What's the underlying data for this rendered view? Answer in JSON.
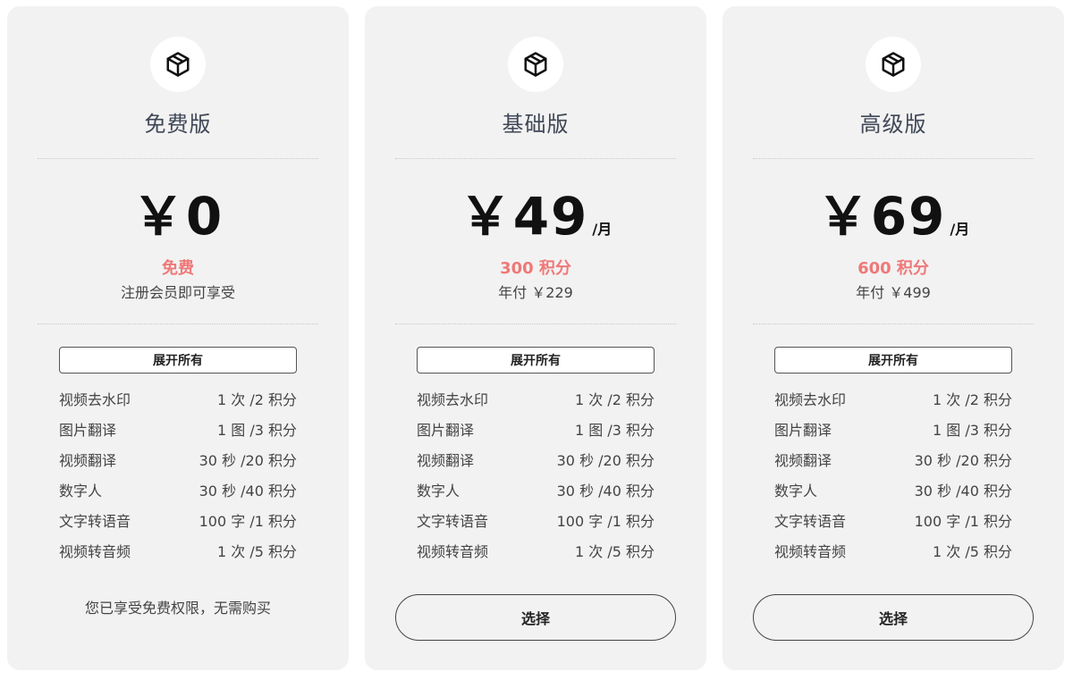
{
  "plans": [
    {
      "name": "免费版",
      "price": "￥0",
      "unit": "",
      "credits": "免费",
      "sub": "注册会员即可享受",
      "expand_label": "展开所有",
      "note": "您已享受免费权限，无需购买",
      "select_label": ""
    },
    {
      "name": "基础版",
      "price": "￥49",
      "unit": "/月",
      "credits": "300 积分",
      "sub": "年付 ￥229",
      "expand_label": "展开所有",
      "note": "",
      "select_label": "选择"
    },
    {
      "name": "高级版",
      "price": "￥69",
      "unit": "/月",
      "credits": "600 积分",
      "sub": "年付 ￥499",
      "expand_label": "展开所有",
      "note": "",
      "select_label": "选择"
    }
  ],
  "features": [
    {
      "name": "视频去水印",
      "cost": "1 次 /2 积分"
    },
    {
      "name": "图片翻译",
      "cost": "1 图 /3 积分"
    },
    {
      "name": "视频翻译",
      "cost": "30 秒 /20 积分"
    },
    {
      "name": "数字人",
      "cost": "30 秒 /40 积分"
    },
    {
      "name": "文字转语音",
      "cost": "100 字 /1 积分"
    },
    {
      "name": "视频转音频",
      "cost": "1 次 /5 积分"
    }
  ],
  "colors": {
    "accent": "#ef7878",
    "card_bg": "#f2f2f2",
    "title": "#3f4756"
  },
  "icons": {
    "plan_icon": "package-box-icon"
  }
}
